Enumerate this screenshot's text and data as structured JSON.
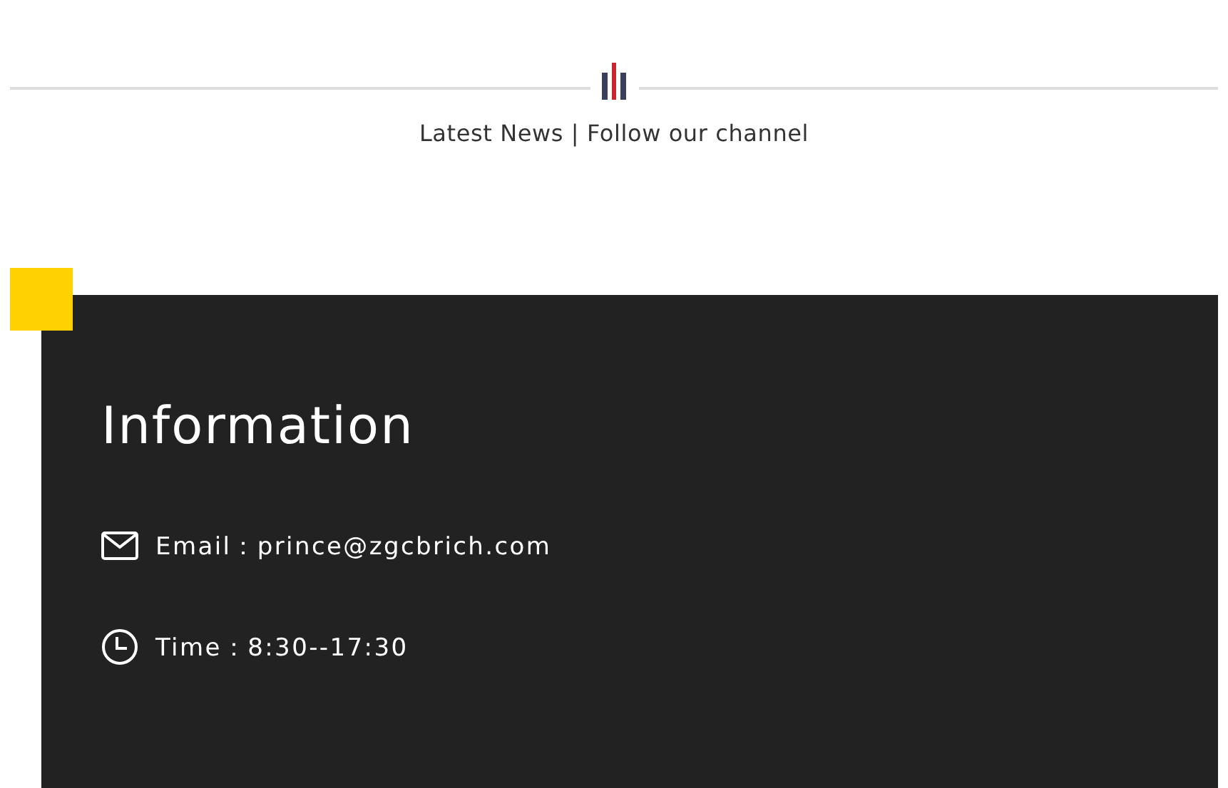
{
  "header": {
    "title": "Latest News | Follow our channel"
  },
  "info": {
    "title": "Information",
    "items": [
      {
        "kind": "email",
        "text": "Email：prince@zgcbrich.com"
      },
      {
        "kind": "time",
        "text": "Time：8:30--17:30"
      }
    ]
  }
}
